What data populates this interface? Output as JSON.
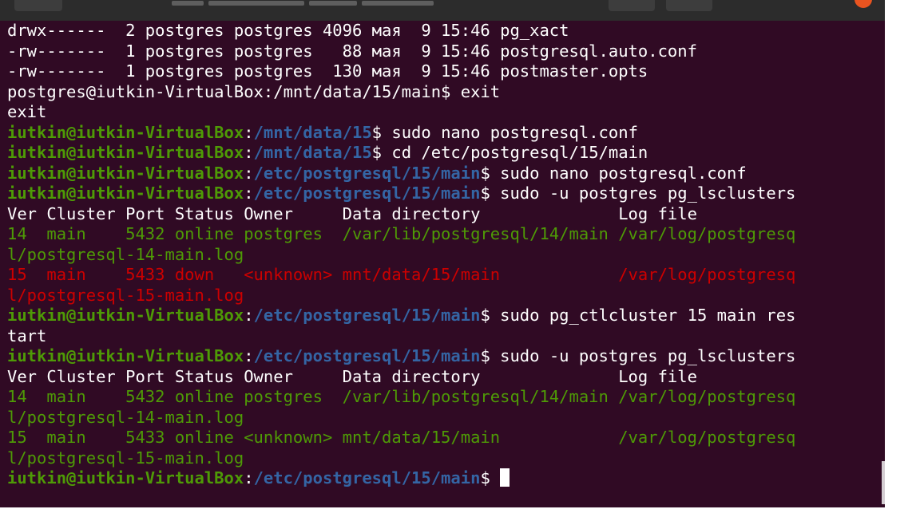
{
  "lines": [
    [
      {
        "c": "w",
        "t": "drwx------  2 postgres postgres 4096 мая  9 15:46 pg_xact"
      }
    ],
    [
      {
        "c": "w",
        "t": "-rw-------  1 postgres postgres   88 мая  9 15:46 postgresql.auto.conf"
      }
    ],
    [
      {
        "c": "w",
        "t": "-rw-------  1 postgres postgres  130 мая  9 15:46 postmaster.opts"
      }
    ],
    [
      {
        "c": "w",
        "t": "postgres@iutkin-VirtualBox:/mnt/data/15/main$ exit"
      }
    ],
    [
      {
        "c": "w",
        "t": "exit"
      }
    ],
    [
      {
        "c": "u",
        "t": "iutkin@iutkin-VirtualBox"
      },
      {
        "c": "w",
        "t": ":"
      },
      {
        "c": "p",
        "t": "/mnt/data/15"
      },
      {
        "c": "w",
        "t": "$ sudo nano postgresql.conf"
      }
    ],
    [
      {
        "c": "u",
        "t": "iutkin@iutkin-VirtualBox"
      },
      {
        "c": "w",
        "t": ":"
      },
      {
        "c": "p",
        "t": "/mnt/data/15"
      },
      {
        "c": "w",
        "t": "$ cd /etc/postgresql/15/main"
      }
    ],
    [
      {
        "c": "u",
        "t": "iutkin@iutkin-VirtualBox"
      },
      {
        "c": "w",
        "t": ":"
      },
      {
        "c": "p",
        "t": "/etc/postgresql/15/main"
      },
      {
        "c": "w",
        "t": "$ sudo nano postgresql.conf"
      }
    ],
    [
      {
        "c": "u",
        "t": "iutkin@iutkin-VirtualBox"
      },
      {
        "c": "w",
        "t": ":"
      },
      {
        "c": "p",
        "t": "/etc/postgresql/15/main"
      },
      {
        "c": "w",
        "t": "$ sudo -u postgres pg_lsclusters"
      }
    ],
    [
      {
        "c": "w",
        "t": "Ver Cluster Port Status Owner     Data directory              Log file"
      }
    ],
    [
      {
        "c": "g",
        "t": "14  main    5432 online postgres  /var/lib/postgresql/14/main /var/log/postgresq"
      }
    ],
    [
      {
        "c": "g",
        "t": "l/postgresql-14-main.log"
      }
    ],
    [
      {
        "c": "r",
        "t": "15  main    5433 down   <unknown> mnt/data/15/main            /var/log/postgresq"
      }
    ],
    [
      {
        "c": "r",
        "t": "l/postgresql-15-main.log"
      }
    ],
    [
      {
        "c": "u",
        "t": "iutkin@iutkin-VirtualBox"
      },
      {
        "c": "w",
        "t": ":"
      },
      {
        "c": "p",
        "t": "/etc/postgresql/15/main"
      },
      {
        "c": "w",
        "t": "$ sudo pg_ctlcluster 15 main res"
      }
    ],
    [
      {
        "c": "w",
        "t": "tart"
      }
    ],
    [
      {
        "c": "u",
        "t": "iutkin@iutkin-VirtualBox"
      },
      {
        "c": "w",
        "t": ":"
      },
      {
        "c": "p",
        "t": "/etc/postgresql/15/main"
      },
      {
        "c": "w",
        "t": "$ sudo -u postgres pg_lsclusters"
      }
    ],
    [
      {
        "c": "w",
        "t": "Ver Cluster Port Status Owner     Data directory              Log file"
      }
    ],
    [
      {
        "c": "g",
        "t": "14  main    5432 online postgres  /var/lib/postgresql/14/main /var/log/postgresq"
      }
    ],
    [
      {
        "c": "g",
        "t": "l/postgresql-14-main.log"
      }
    ],
    [
      {
        "c": "g",
        "t": "15  main    5433 online <unknown> mnt/data/15/main            /var/log/postgresq"
      }
    ],
    [
      {
        "c": "g",
        "t": "l/postgresql-15-main.log"
      }
    ]
  ],
  "prompt": {
    "user": "iutkin@iutkin-VirtualBox",
    "sep": ":",
    "path": "/etc/postgresql/15/main",
    "symbol": "$ "
  },
  "colors": {
    "background": "#300a24",
    "user_host": "#4e9a06",
    "path": "#3465a4",
    "online": "#4e9a06",
    "down": "#cc0000",
    "text": "#ffffff"
  }
}
